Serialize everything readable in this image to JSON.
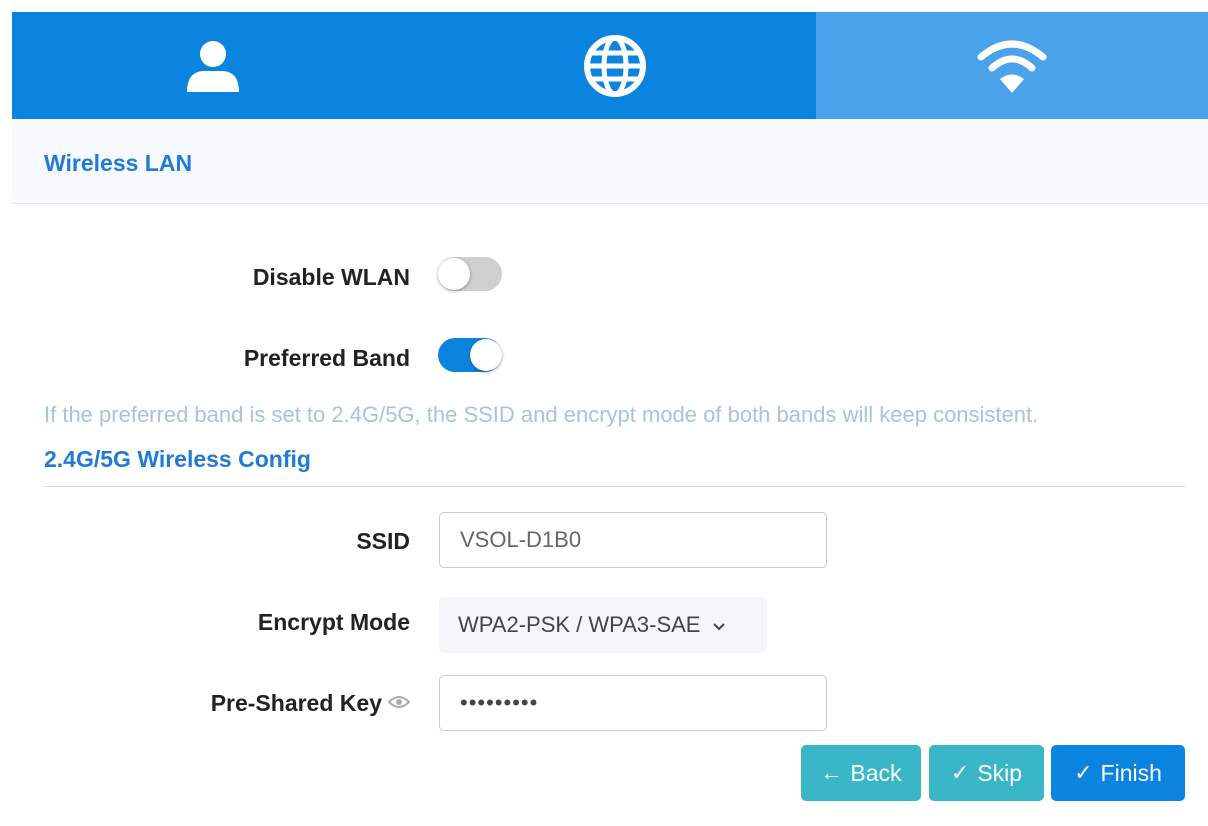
{
  "wizard": {
    "steps": [
      {
        "icon": "user-icon",
        "active": true
      },
      {
        "icon": "globe-icon",
        "active": true
      },
      {
        "icon": "wifi-icon",
        "active": false
      }
    ]
  },
  "section": {
    "title": "Wireless LAN"
  },
  "form": {
    "disable_wlan": {
      "label": "Disable WLAN",
      "checked": false
    },
    "preferred_band": {
      "label": "Preferred Band",
      "checked": true
    },
    "hint": "If the preferred band is set to 2.4G/5G, the SSID and encrypt mode of both bands will keep consistent.",
    "subsection_title": "2.4G/5G Wireless Config",
    "ssid": {
      "label": "SSID",
      "value": "VSOL-D1B0"
    },
    "encrypt_mode": {
      "label": "Encrypt Mode",
      "value": "WPA2-PSK / WPA3-SAE"
    },
    "psk": {
      "label": "Pre-Shared Key",
      "value": "•••••••••"
    }
  },
  "buttons": {
    "back": {
      "glyph": "←",
      "label": "Back"
    },
    "skip": {
      "glyph": "✓",
      "label": "Skip"
    },
    "finish": {
      "glyph": "✓",
      "label": "Finish"
    }
  },
  "colors": {
    "primary": "#0b84e0",
    "step_inactive": "#4aa3ea",
    "teal": "#3ab7c7",
    "title_blue": "#1f7bd3",
    "hint": "#a6c4de"
  }
}
